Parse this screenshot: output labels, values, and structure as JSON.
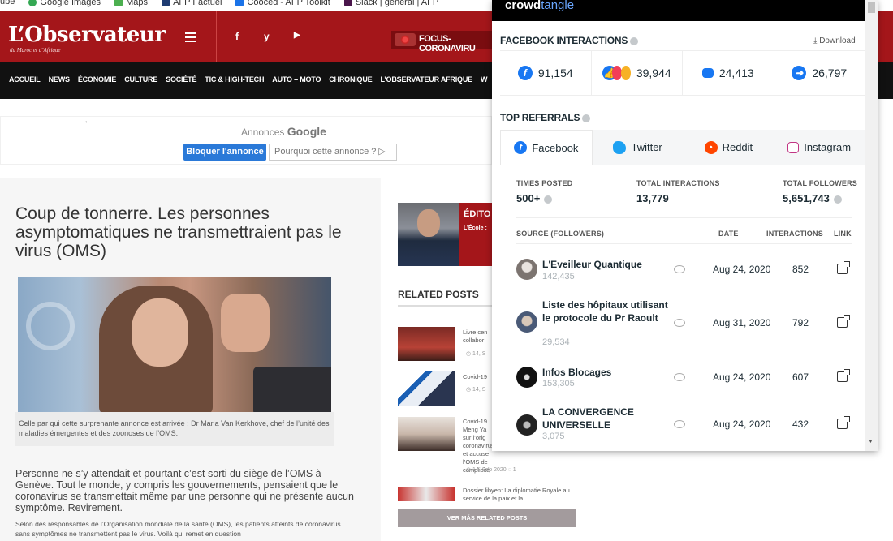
{
  "bookmarks": [
    "ube",
    "Google Images",
    "Maps",
    "AFP Factuel",
    "Cooced - AFP Toolkit",
    "Slack | général | AFP"
  ],
  "site": {
    "logo": "L’Observateur",
    "logo_sub": "du Maroc et d’Afrique",
    "social": [
      "f",
      "y",
      "▶"
    ],
    "focus": "FOCUS-CORONAVIRU",
    "nav": [
      "ACCUEIL",
      "NEWS",
      "ÉCONOMIE",
      "CULTURE",
      "SOCIÉTÉ",
      "TIC & HIGH-TECH",
      "AUTO – MOTO",
      "CHRONIQUE",
      "L’OBSERVATEUR AFRIQUE",
      "W"
    ]
  },
  "ad": {
    "label": "Annonces",
    "brand": "Google",
    "block": "Bloquer l'annonce",
    "why": "Pourquoi cette annonce ? ▷"
  },
  "article": {
    "title": "Coup de tonnerre. Les personnes asymptomatiques ne transmettraient pas le virus (OMS)",
    "caption": "Celle par qui cette surprenante annonce est arrivée : Dr Maria Van Kerkhove, chef de l’unité des maladies émergentes et des zoonoses de l’OMS.",
    "lead": "Personne ne s’y attendait et pourtant c’est sorti du siège de l’OMS à Genève. Tout le monde, y compris les gouvernements, pensaient que le coronavirus se transmettait même par une personne qui ne présente aucun symptôme. Revirement.",
    "body": "Selon des responsables de l’Organisation mondiale de la santé (OMS), les patients atteints de coronavirus sans symptômes ne transmettent pas le virus. Voilà qui remet en question"
  },
  "sidebar": {
    "edito": "ÉDITO",
    "edito_sub": "L’École :",
    "related_title": "RELATED POSTS",
    "posts": [
      {
        "text": "Livre cen collabor",
        "meta": "◷ 14, S"
      },
      {
        "text": "Covid-19",
        "meta": "◷ 14, S"
      },
      {
        "text": "Covid-19 Meng Ya sur l’orig coronavirus et accuse l’OMS de complicité (vidéo)",
        "meta": "◷ 14, Sep 2020  ◌ 1"
      },
      {
        "text": "Dossier libyen: La diplomatie Royale au service de la paix et la",
        "meta": ""
      }
    ],
    "more": "VER MÁS RELATED POSTS"
  },
  "crowdtangle": {
    "logo_a": "crowd",
    "logo_b": "tangle",
    "interactions_title": "FACEBOOK INTERACTIONS",
    "download": "⤓ Download",
    "stats": [
      "91,154",
      "39,944",
      "24,413",
      "26,797"
    ],
    "referrals_title": "TOP REFERRALS",
    "tabs": [
      "Facebook",
      "Twitter",
      "Reddit",
      "Instagram"
    ],
    "kpis": {
      "times_posted_label": "TIMES POSTED",
      "times_posted": "500+",
      "total_interactions_label": "TOTAL INTERACTIONS",
      "total_interactions": "13,779",
      "total_followers_label": "TOTAL FOLLOWERS",
      "total_followers": "5,651,743"
    },
    "columns": [
      "SOURCE (FOLLOWERS)",
      "DATE",
      "INTERACTIONS",
      "LINK"
    ],
    "rows": [
      {
        "name": "L'Eveilleur Quantique",
        "followers": "142,435",
        "date": "Aug 24, 2020",
        "interactions": "852"
      },
      {
        "name": "Liste des hôpitaux utilisant le protocole du Pr Raoult",
        "followers": "29,534",
        "date": "Aug 31, 2020",
        "interactions": "792"
      },
      {
        "name": "Infos Blocages",
        "followers": "153,305",
        "date": "Aug 24, 2020",
        "interactions": "607"
      },
      {
        "name": "LA CONVERGENCE UNIVERSELLE",
        "followers": "3,075",
        "date": "Aug 24, 2020",
        "interactions": "432"
      }
    ]
  },
  "colors": {
    "brand_red": "#a4161a",
    "facebook_blue": "#1877f2",
    "twitter_blue": "#1da1f2",
    "reddit_orange": "#ff4500",
    "instagram_pink": "#c13584"
  }
}
